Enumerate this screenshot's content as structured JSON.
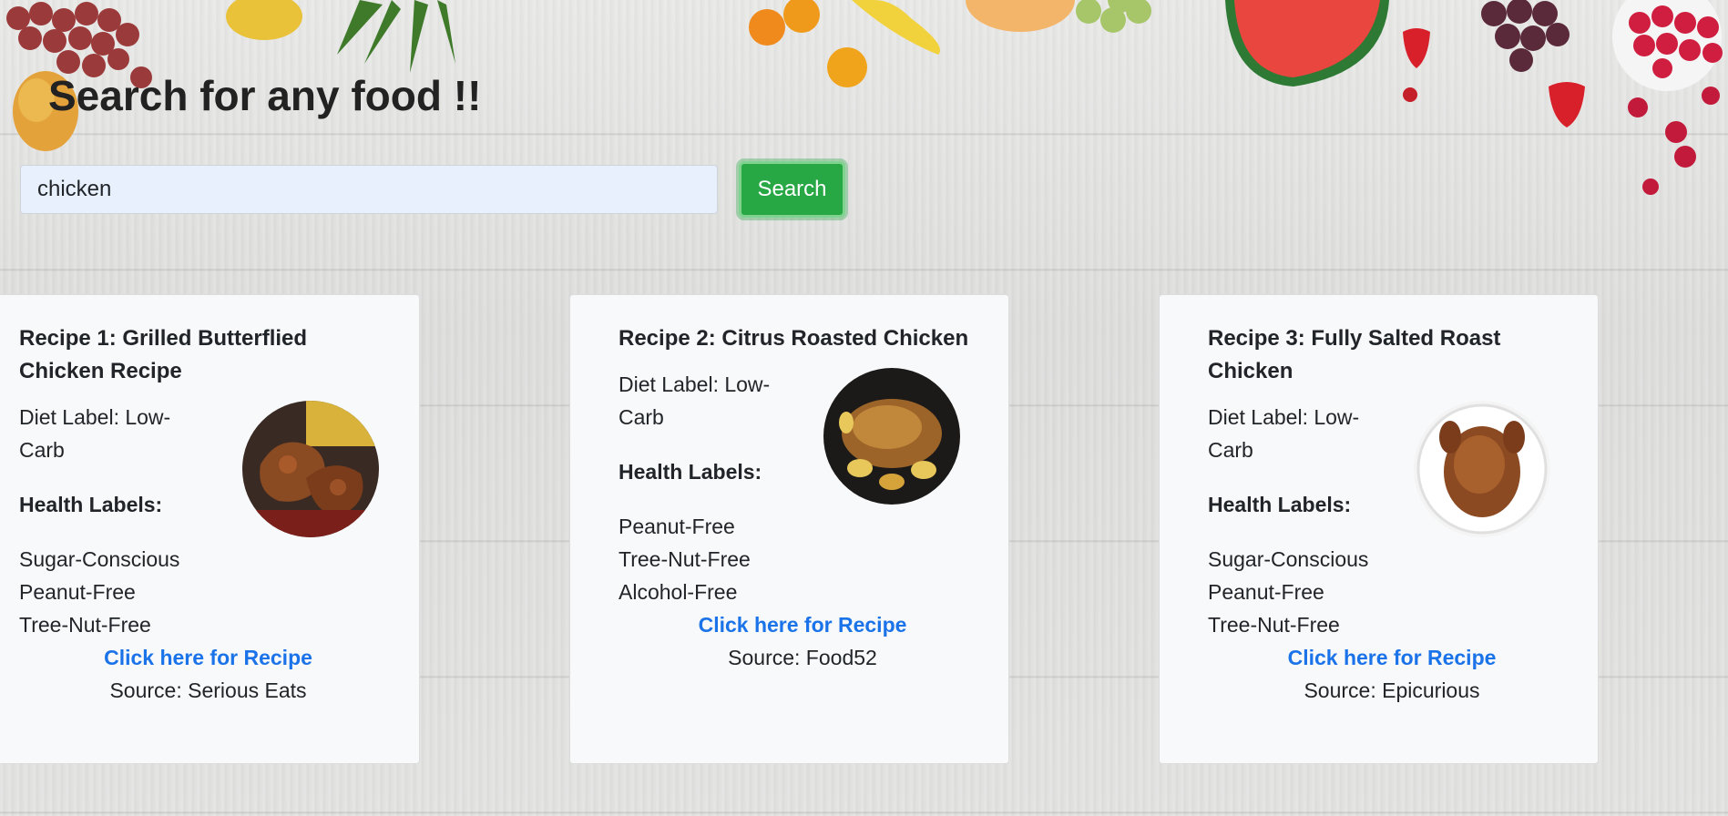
{
  "page": {
    "title": "Search for any food !!"
  },
  "search": {
    "value": "chicken",
    "button_label": "Search"
  },
  "recipes": [
    {
      "title": "Recipe 1: Grilled Butterflied Chicken Recipe",
      "diet": "Diet Label: Low-Carb",
      "health_title": "Health Labels:",
      "health": [
        "Sugar-Conscious",
        "Peanut-Free",
        "Tree-Nut-Free"
      ],
      "link": "Click here for Recipe",
      "source": "Source: Serious Eats"
    },
    {
      "title": "Recipe 2: Citrus Roasted Chicken",
      "diet": "Diet Label: Low-Carb",
      "health_title": "Health Labels:",
      "health": [
        "Peanut-Free",
        "Tree-Nut-Free",
        "Alcohol-Free"
      ],
      "link": "Click here for Recipe",
      "source": "Source: Food52"
    },
    {
      "title": "Recipe 3: Fully Salted Roast Chicken",
      "diet": "Diet Label: Low-Carb",
      "health_title": "Health Labels:",
      "health": [
        "Sugar-Conscious",
        "Peanut-Free",
        "Tree-Nut-Free"
      ],
      "link": "Click here for Recipe",
      "source": "Source: Epicurious"
    }
  ],
  "colors": {
    "search_button": "#28a745",
    "link": "#1a73e8",
    "card_bg": "#f8f9fa",
    "input_bg": "#e8f0fe"
  }
}
